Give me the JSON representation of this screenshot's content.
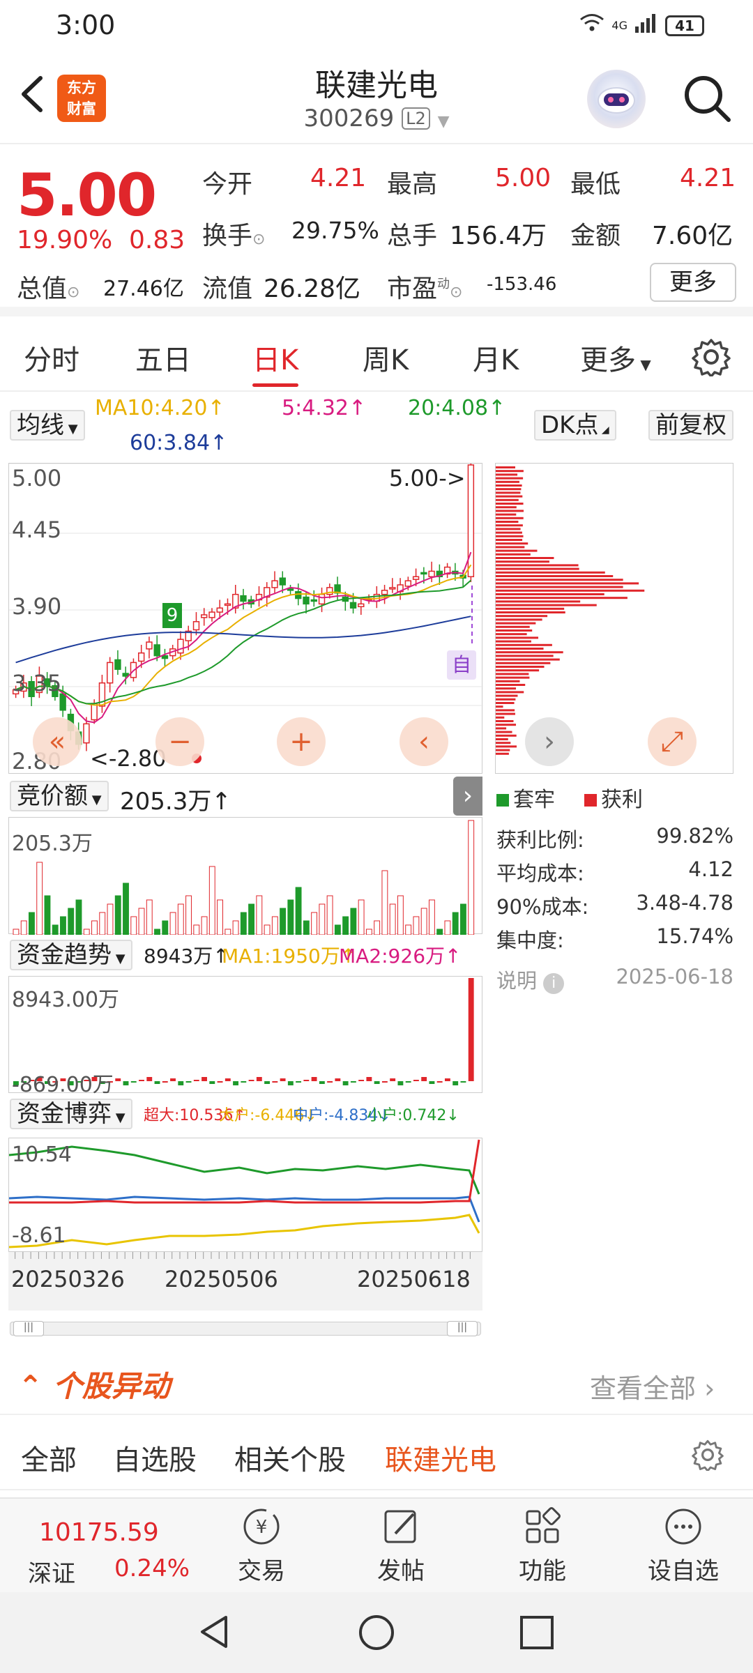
{
  "status_bar": {
    "time": "3:00",
    "network": "4G",
    "battery": "41"
  },
  "header": {
    "title": "联建光电",
    "code": "300269",
    "level": "L2",
    "logo_line1": "东方",
    "logo_line2": "财富"
  },
  "quote": {
    "price": "5.00",
    "change_pct": "19.90%",
    "change": "0.83",
    "open_label": "今开",
    "open": "4.21",
    "high_label": "最高",
    "high": "5.00",
    "low_label": "最低",
    "low": "4.21",
    "turnover_label": "换手",
    "turnover": "29.75%",
    "volume_label": "总手",
    "volume": "156.4万",
    "amount_label": "金额",
    "amount": "7.60亿",
    "mktcap_label": "总值",
    "mktcap": "27.46亿",
    "float_label": "流值",
    "float_cap": "26.28亿",
    "pe_label": "市盈",
    "pe_sup": "动",
    "pe": "-153.46",
    "more": "更多"
  },
  "tabs": [
    "分时",
    "五日",
    "日K",
    "周K",
    "月K",
    "更多"
  ],
  "active_tab": "日K",
  "ma_bar": {
    "select": "均线",
    "ma10": "MA10:4.20↑",
    "ma5": "5:4.32↑",
    "ma20": "20:4.08↑",
    "ma60": "60:3.84↑",
    "dk": "DK点",
    "fq": "前复权"
  },
  "colors": {
    "ma5": "#d81b80",
    "ma10": "#e8b000",
    "ma20": "#1e9a2b",
    "ma60": "#1d3c9a",
    "up": "#e0262b",
    "down": "#1e9a2b",
    "accent": "#e8551d"
  },
  "kline": {
    "y_labels": [
      "5.00",
      "4.45",
      "3.90",
      "3.35",
      "2.80"
    ],
    "last_marker": "5.00->",
    "low_marker": "<-2.80",
    "badge_zi": "自",
    "badge_nine": "9",
    "ylim": [
      2.8,
      5.0
    ]
  },
  "chip": {
    "legend_trapped": "套牢",
    "legend_profit": "获利",
    "profit_ratio_label": "获利比例:",
    "profit_ratio": "99.82%",
    "avg_cost_label": "平均成本:",
    "avg_cost": "4.12",
    "cost90_label": "90%成本:",
    "cost90": "3.48-4.78",
    "concentration_label": "集中度:",
    "concentration": "15.74%",
    "note": "说明",
    "date": "2025-06-18"
  },
  "auction": {
    "select": "竞价额",
    "value": "205.3万↑",
    "axis_top": "205.3万"
  },
  "fund_trend": {
    "select": "资金趋势",
    "value": "8943万↑",
    "ma1": "MA1:1950万↑",
    "ma2": "MA2:926万↑",
    "axis_top": "8943.00万",
    "axis_bottom": "-869.00万"
  },
  "fund_game": {
    "select": "资金博弈",
    "super": "超大:10.536↑",
    "big": "大户:-6.446↓",
    "mid": "中户:-4.834↓",
    "small": "小户:0.742↓",
    "axis_top": "10.54",
    "axis_bottom": "-8.61"
  },
  "date_axis": [
    "20250326",
    "20250506",
    "20250618"
  ],
  "yidong": {
    "title": "个股异动",
    "view_all": "查看全部"
  },
  "subtabs": [
    "全部",
    "自选股",
    "相关个股",
    "联建光电"
  ],
  "active_subtab": "联建光电",
  "bottom_nav": {
    "index_value": "10175.59",
    "index_name": "深证",
    "index_pct": "0.24%",
    "trade": "交易",
    "post": "发帖",
    "function": "功能",
    "watch": "设自选"
  },
  "chart_data": [
    {
      "type": "table",
      "title": "",
      "note": "candlestick daily K approximate closes",
      "y_range": [
        2.8,
        5.0
      ],
      "x_ticks": [
        "20250326",
        "20250506",
        "20250618"
      ],
      "last_close": 5.0,
      "period_low": 2.8,
      "closes": [
        3.35,
        3.4,
        3.3,
        3.45,
        3.38,
        3.3,
        3.2,
        3.05,
        2.95,
        3.1,
        3.25,
        3.4,
        3.55,
        3.5,
        3.45,
        3.55,
        3.62,
        3.7,
        3.6,
        3.58,
        3.65,
        3.72,
        3.78,
        3.85,
        3.9,
        3.92,
        3.95,
        3.98,
        4.05,
        4.0,
        3.98,
        4.05,
        4.1,
        4.15,
        4.12,
        4.08,
        4.02,
        3.98,
        4.0,
        4.05,
        4.1,
        4.06,
        4.0,
        3.95,
        3.98,
        4.02,
        4.05,
        4.08,
        4.1,
        4.12,
        4.15,
        4.18,
        4.2,
        4.22,
        4.18,
        4.25,
        4.2,
        4.17,
        5.0
      ]
    }
  ]
}
